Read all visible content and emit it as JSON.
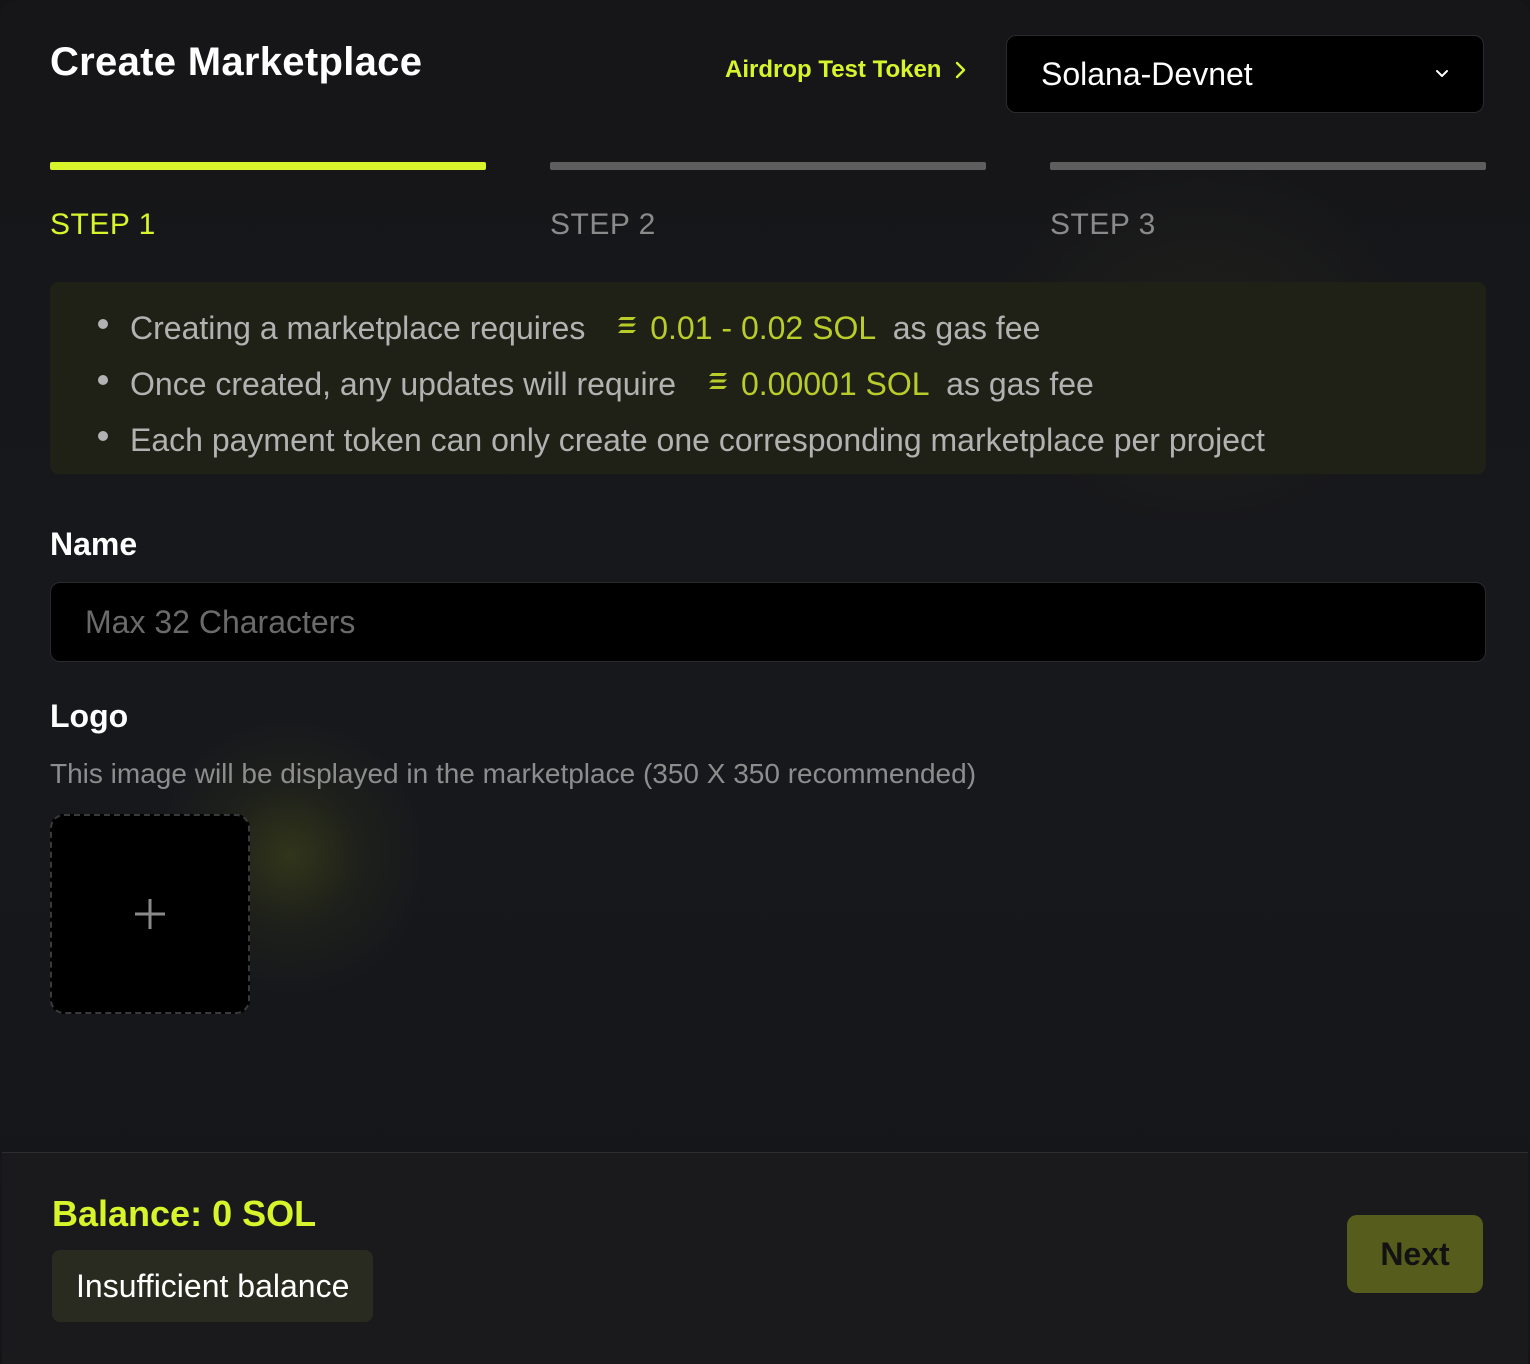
{
  "header": {
    "title": "Create Marketplace",
    "airdrop_label": "Airdrop Test Token",
    "network_selected": "Solana-Devnet"
  },
  "steps": [
    {
      "label": "STEP 1",
      "active": true
    },
    {
      "label": "STEP 2",
      "active": false
    },
    {
      "label": "STEP 3",
      "active": false
    }
  ],
  "info": {
    "line1_pre": "Creating a marketplace requires",
    "line1_amount": "0.01 - 0.02 SOL",
    "line1_post": "as gas fee",
    "line2_pre": "Once created, any updates will require",
    "line2_amount": "0.00001 SOL",
    "line2_post": "as gas fee",
    "line3": "Each payment token can only create one corresponding marketplace per project"
  },
  "form": {
    "name_label": "Name",
    "name_placeholder": "Max 32 Characters",
    "name_value": "",
    "logo_label": "Logo",
    "logo_description": "This image will be displayed in the marketplace (350 X 350 recommended)"
  },
  "footer": {
    "balance": "Balance: 0 SOL",
    "status": "Insufficient balance",
    "next_label": "Next"
  },
  "colors": {
    "accent": "#d7f52a",
    "inactive_bar": "#5e5e5e",
    "inactive_step": "#8a8a8a",
    "next_button": "#565c1c"
  },
  "icons": {
    "airdrop": "chevron-right-icon",
    "network": "chevron-down-icon",
    "fee": "sol-icon",
    "upload": "plus-icon"
  }
}
